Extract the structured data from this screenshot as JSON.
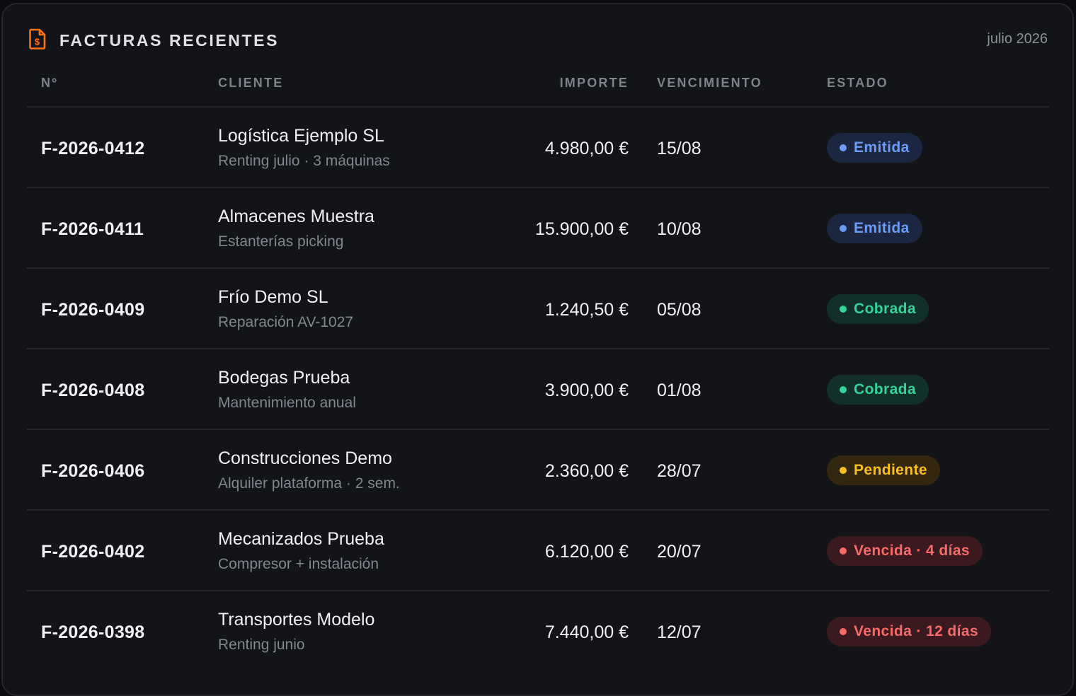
{
  "header": {
    "title": "FACTURAS RECIENTES",
    "period": "julio 2026",
    "icon": "invoice-euro-icon"
  },
  "columns": {
    "number": "Nº",
    "client": "CLIENTE",
    "amount": "IMPORTE",
    "due": "VENCIMIENTO",
    "status": "ESTADO"
  },
  "status_colors": {
    "emitida": "#6d9cf5",
    "cobrada": "#34d399",
    "pendiente": "#fbbf24",
    "vencida": "#f86a6a",
    "icon_accent": "#f97316"
  },
  "invoices": [
    {
      "number": "F-2026-0412",
      "client": "Logística Ejemplo SL",
      "description": "Renting julio · 3 máquinas",
      "amount": "4.980,00 €",
      "due": "15/08",
      "status": "Emitida",
      "status_key": "emitida"
    },
    {
      "number": "F-2026-0411",
      "client": "Almacenes Muestra",
      "description": "Estanterías picking",
      "amount": "15.900,00 €",
      "due": "10/08",
      "status": "Emitida",
      "status_key": "emitida"
    },
    {
      "number": "F-2026-0409",
      "client": "Frío Demo SL",
      "description": "Reparación AV-1027",
      "amount": "1.240,50 €",
      "due": "05/08",
      "status": "Cobrada",
      "status_key": "cobrada"
    },
    {
      "number": "F-2026-0408",
      "client": "Bodegas Prueba",
      "description": "Mantenimiento anual",
      "amount": "3.900,00 €",
      "due": "01/08",
      "status": "Cobrada",
      "status_key": "cobrada"
    },
    {
      "number": "F-2026-0406",
      "client": "Construcciones Demo",
      "description": "Alquiler plataforma · 2 sem.",
      "amount": "2.360,00 €",
      "due": "28/07",
      "status": "Pendiente",
      "status_key": "pendiente"
    },
    {
      "number": "F-2026-0402",
      "client": "Mecanizados Prueba",
      "description": "Compresor + instalación",
      "amount": "6.120,00 €",
      "due": "20/07",
      "status": "Vencida · 4 días",
      "status_key": "vencida"
    },
    {
      "number": "F-2026-0398",
      "client": "Transportes Modelo",
      "description": "Renting junio",
      "amount": "7.440,00 €",
      "due": "12/07",
      "status": "Vencida · 12 días",
      "status_key": "vencida"
    }
  ]
}
